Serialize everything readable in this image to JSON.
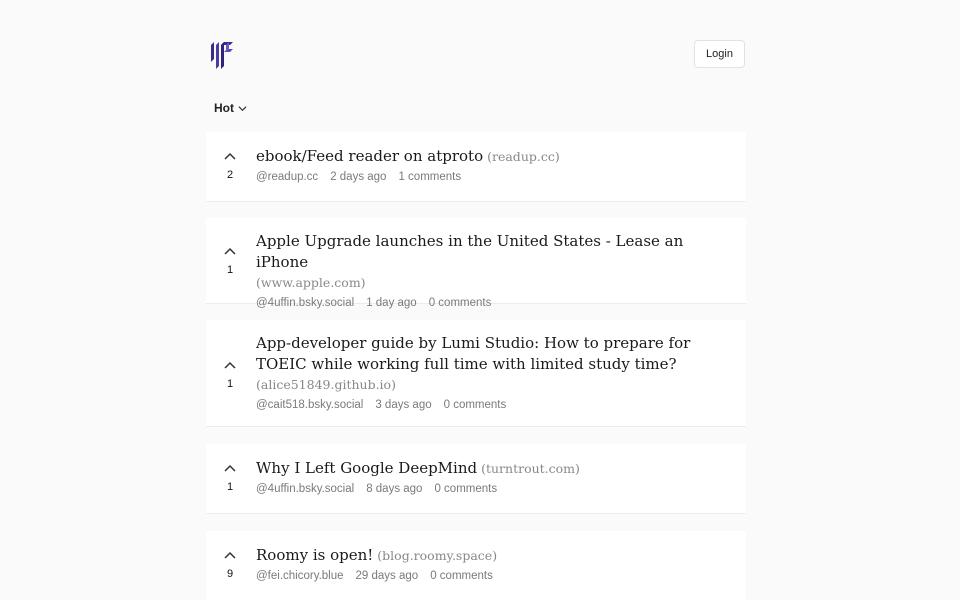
{
  "header": {
    "login_label": "Login"
  },
  "sort": {
    "label": "Hot"
  },
  "posts": [
    {
      "votes": "2",
      "title": "ebook/Feed reader on atproto",
      "domain": "(readup.cc)",
      "author": "@readup.cc",
      "time": "2 days ago",
      "comments": "1 comments"
    },
    {
      "votes": "1",
      "title": "Apple Upgrade launches in the United States - Lease an iPhone",
      "domain": "(www.apple.com)",
      "author": "@4uffin.bsky.social",
      "time": "1 day ago",
      "comments": "0 comments"
    },
    {
      "votes": "1",
      "title": "App-developer guide by Lumi Studio: How to prepare for TOEIC while working full time with limited study time?",
      "domain": "(alice51849.github.io)",
      "author": "@cait518.bsky.social",
      "time": "3 days ago",
      "comments": "0 comments"
    },
    {
      "votes": "1",
      "title": "Why I Left Google DeepMind",
      "domain": "(turntrout.com)",
      "author": "@4uffin.bsky.social",
      "time": "8 days ago",
      "comments": "0 comments"
    },
    {
      "votes": "9",
      "title": "Roomy is open!",
      "domain": "(blog.roomy.space)",
      "author": "@fei.chicory.blue",
      "time": "29 days ago",
      "comments": "0 comments"
    }
  ]
}
